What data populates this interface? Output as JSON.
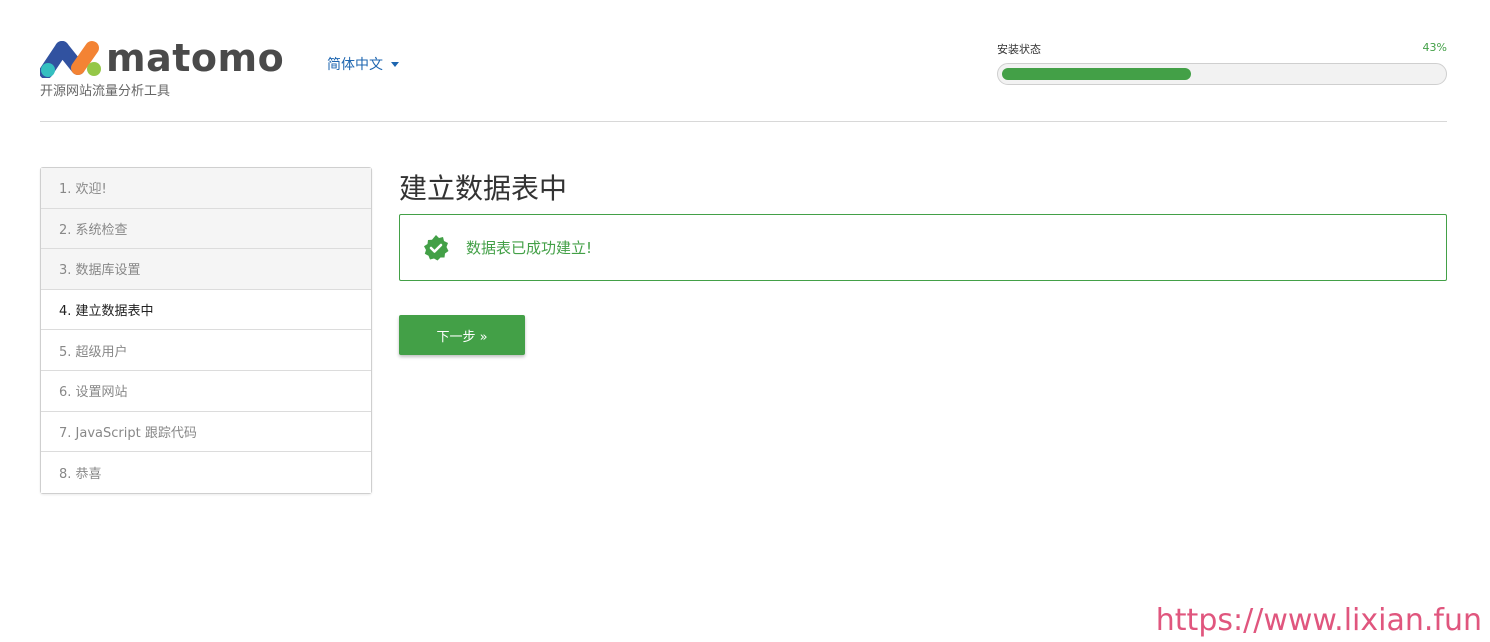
{
  "header": {
    "logo_text": "matomo",
    "tagline": "开源网站流量分析工具",
    "language": "简体中文",
    "progress_label": "安装状态",
    "progress_percent_text": "43%",
    "progress_value": 0.43
  },
  "steps": [
    {
      "label": "1. 欢迎!",
      "state": "done"
    },
    {
      "label": "2. 系统检查",
      "state": "done"
    },
    {
      "label": "3. 数据库设置",
      "state": "done"
    },
    {
      "label": "4. 建立数据表中",
      "state": "current"
    },
    {
      "label": "5. 超级用户",
      "state": "todo"
    },
    {
      "label": "6. 设置网站",
      "state": "todo"
    },
    {
      "label": "7. JavaScript 跟踪代码",
      "state": "todo"
    },
    {
      "label": "8. 恭喜",
      "state": "todo"
    }
  ],
  "main": {
    "title": "建立数据表中",
    "success_message": "数据表已成功建立!",
    "next_button": "下一步 »"
  },
  "watermark": "https://www.lixian.fun",
  "colors": {
    "accent_green": "#43a047",
    "link_blue": "#1e66b0",
    "watermark_pink": "#e0567e"
  }
}
